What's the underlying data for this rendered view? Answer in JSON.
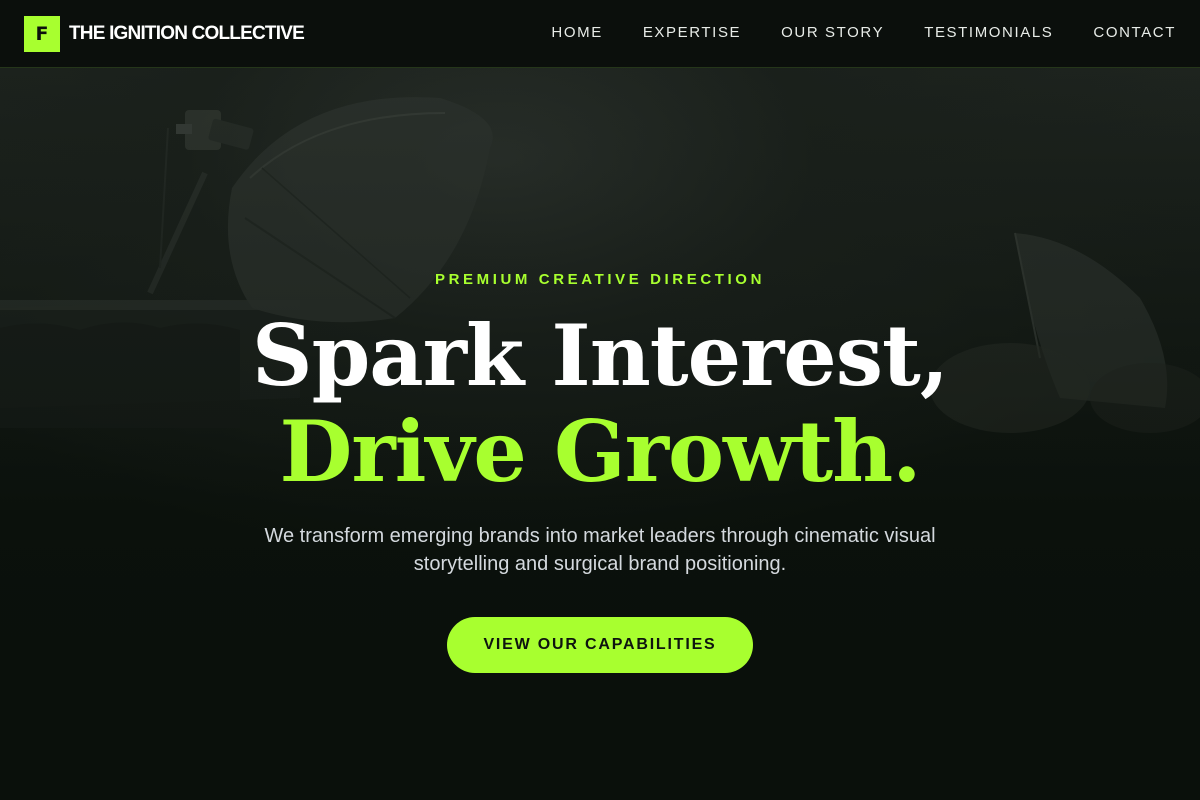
{
  "brand": {
    "mark": "F",
    "name": "THE IGNITION COLLECTIVE"
  },
  "nav": {
    "items": [
      {
        "label": "HOME"
      },
      {
        "label": "EXPERTISE"
      },
      {
        "label": "OUR STORY"
      },
      {
        "label": "TESTIMONIALS"
      },
      {
        "label": "CONTACT"
      }
    ]
  },
  "hero": {
    "eyebrow": "PREMIUM CREATIVE DIRECTION",
    "headline_line1": "Spark Interest,",
    "headline_line2": "Drive Growth.",
    "subtitle": "We transform emerging brands into market leaders through cinematic visual storytelling and surgical brand positioning.",
    "cta_label": "VIEW OUR CAPABILITIES"
  },
  "colors": {
    "accent": "#a8ff2f",
    "background": "#0a100b",
    "header_bg": "#0b0f0c",
    "text": "#ffffff",
    "subtitle_text": "#d4d9de"
  }
}
